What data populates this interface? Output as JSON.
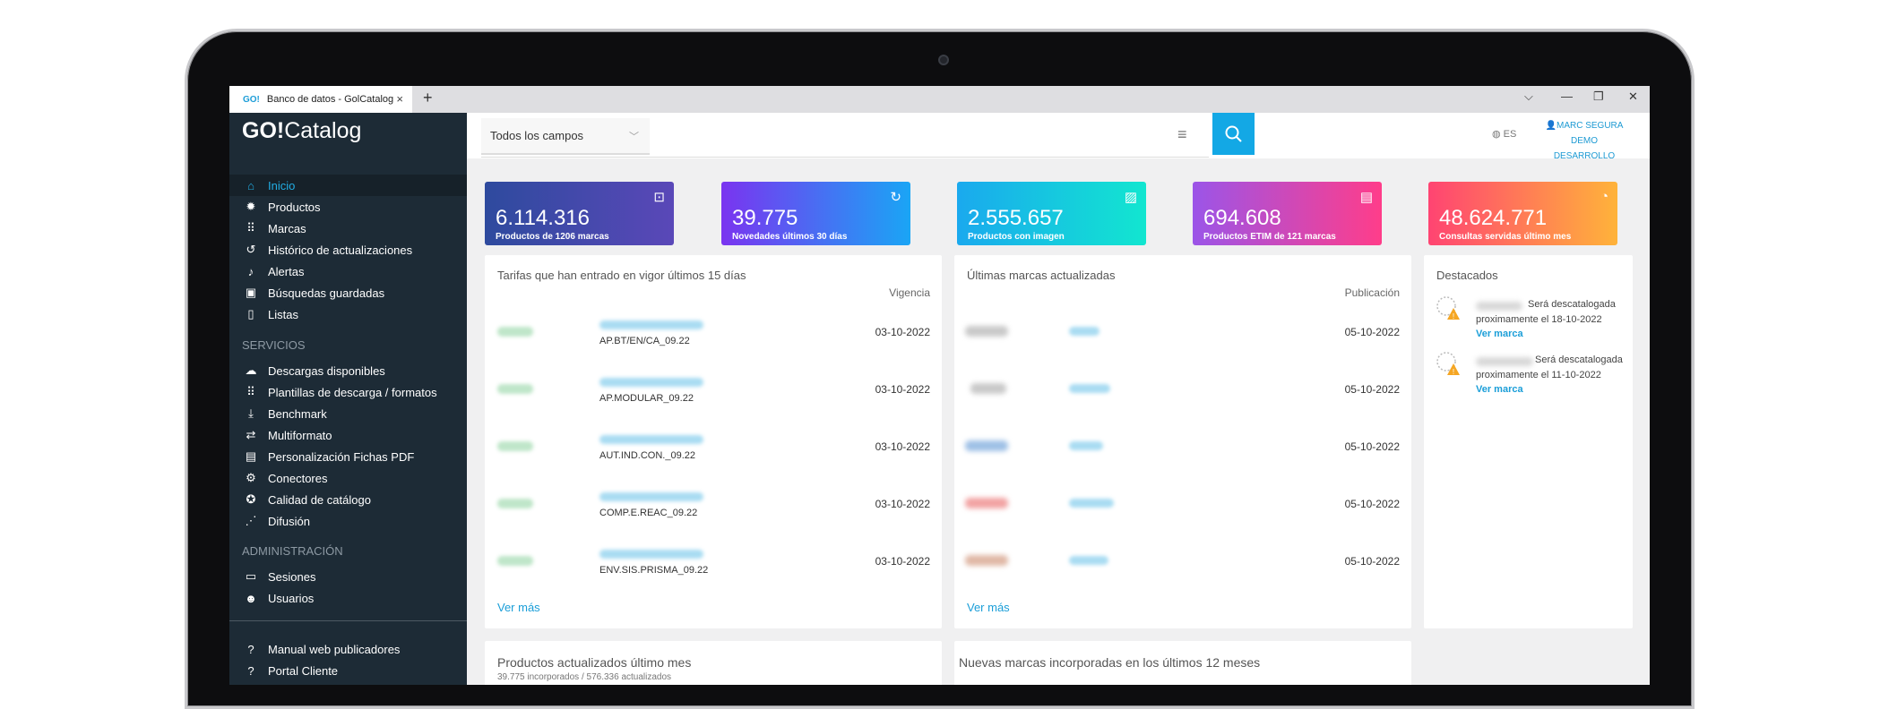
{
  "browser": {
    "tab_icon": "GO!",
    "tab_title": "Banco de datos - GolCatalog",
    "tab_close": "×",
    "new_tab": "+",
    "controls": [
      "⌵",
      "—",
      "❐",
      "✕"
    ]
  },
  "app": {
    "logo_bold": "GO!",
    "logo_rest": "Catalog"
  },
  "sidebar": {
    "items": [
      {
        "label": "Inicio",
        "icon": "home-icon"
      },
      {
        "label": "Productos",
        "icon": "lightbulb-icon"
      },
      {
        "label": "Marcas",
        "icon": "grid-icon"
      },
      {
        "label": "Histórico de actualizaciones",
        "icon": "history-icon"
      },
      {
        "label": "Alertas",
        "icon": "bell-icon"
      },
      {
        "label": "Búsquedas guardadas",
        "icon": "saved-search-icon"
      },
      {
        "label": "Listas",
        "icon": "bookmark-icon"
      }
    ],
    "section_services": "SERVICIOS",
    "services": [
      {
        "label": "Descargas disponibles",
        "icon": "cloud-download-icon"
      },
      {
        "label": "Plantillas de descarga / formatos",
        "icon": "grid-icon"
      },
      {
        "label": "Benchmark",
        "icon": "download-icon"
      },
      {
        "label": "Multiformato",
        "icon": "transform-icon"
      },
      {
        "label": "Personalización Fichas PDF",
        "icon": "pdf-icon"
      },
      {
        "label": "Conectores",
        "icon": "connector-icon"
      },
      {
        "label": "Calidad de catálogo",
        "icon": "quality-icon"
      },
      {
        "label": "Difusión",
        "icon": "rss-icon"
      }
    ],
    "section_admin": "ADMINISTRACIÓN",
    "admin": [
      {
        "label": "Sesiones",
        "icon": "sessions-icon"
      },
      {
        "label": "Usuarios",
        "icon": "users-icon"
      }
    ],
    "help": [
      {
        "label": "Manual web publicadores",
        "icon": "help-icon"
      },
      {
        "label": "Portal Cliente",
        "icon": "help-icon"
      }
    ]
  },
  "header": {
    "field_select": "Todos los campos",
    "lang": "ES",
    "user_name": "MARC SEGURA",
    "user_company": "DEMO DESARROLLO"
  },
  "stats": [
    {
      "value": "6.114.316",
      "label": "Productos de 1206 marcas",
      "icon": "box-icon",
      "color_from": "#2e4a9e",
      "color_to": "#5a48b8"
    },
    {
      "value": "39.775",
      "label": "Novedades últimos 30 días",
      "icon": "refresh-icon",
      "color_from": "#7a34f0",
      "color_to": "#1aa5f5"
    },
    {
      "value": "2.555.657",
      "label": "Productos con imagen",
      "icon": "image-icon",
      "color_from": "#1aa9ee",
      "color_to": "#12e6d0"
    },
    {
      "value": "694.608",
      "label": "Productos ETIM de 121 marcas",
      "icon": "document-icon",
      "color_from": "#9b55e8",
      "color_to": "#ff3d8a"
    },
    {
      "value": "48.624.771",
      "label": "Consultas servidas último mes",
      "icon": "chat-icon",
      "color_from": "#ff4472",
      "color_to": "#ffb33a"
    }
  ],
  "tariffs": {
    "title": "Tarifas que han entrado en vigor últimos 15 días",
    "column": "Vigencia",
    "rows": [
      {
        "code": "AP.BT/EN/CA_09.22",
        "date": "03-10-2022"
      },
      {
        "code": "AP.MODULAR_09.22",
        "date": "03-10-2022"
      },
      {
        "code": "AUT.IND.CON._09.22",
        "date": "03-10-2022"
      },
      {
        "code": "COMP.E.REAC_09.22",
        "date": "03-10-2022"
      },
      {
        "code": "ENV.SIS.PRISMA_09.22",
        "date": "03-10-2022"
      }
    ],
    "more": "Ver más"
  },
  "brands": {
    "title": "Últimas marcas actualizadas",
    "column": "Publicación",
    "rows": [
      {
        "date": "05-10-2022"
      },
      {
        "date": "05-10-2022"
      },
      {
        "date": "05-10-2022"
      },
      {
        "date": "05-10-2022"
      },
      {
        "date": "05-10-2022"
      }
    ],
    "more": "Ver más"
  },
  "featured": {
    "title": "Destacados",
    "items": [
      {
        "status": "Será descatalogada",
        "detail": "proximamente el 18-10-2022",
        "link": "Ver marca"
      },
      {
        "status": "Será descatalogada",
        "detail": "proximamente el 11-10-2022",
        "link": "Ver marca"
      }
    ]
  },
  "bottom": {
    "products_title": "Productos actualizados último mes",
    "products_sub": "39.775 incorporados / 576.336 actualizados",
    "new_brands_title": "Nuevas marcas incorporadas en los últimos 12 meses"
  }
}
